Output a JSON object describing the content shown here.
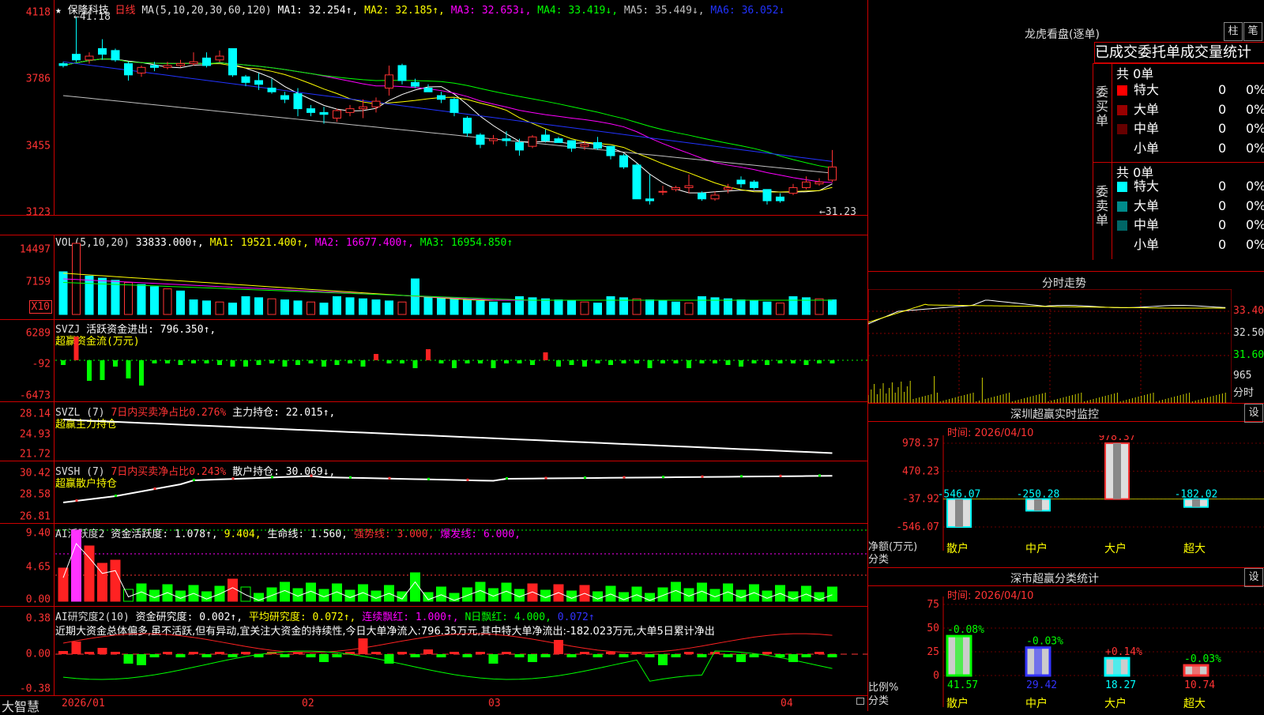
{
  "app": {
    "brand": "大智慧"
  },
  "main": {
    "star": "★",
    "stock_name": "保隆科技",
    "period": "日线",
    "ma_label": "MA(5,10,20,30,60,120)",
    "mas": [
      {
        "text": "MA1: 32.254↑,",
        "color": "#ffffff"
      },
      {
        "text": "MA2: 32.185↑,",
        "color": "#ffff00"
      },
      {
        "text": "MA3: 32.653↓,",
        "color": "#ff00ff"
      },
      {
        "text": "MA4: 33.419↓,",
        "color": "#00ff00"
      },
      {
        "text": "MA5: 35.449↓,",
        "color": "#c0c0c0"
      },
      {
        "text": "MA6: 36.052↓",
        "color": "#2233ff"
      }
    ],
    "y_labels": [
      "4118",
      "3786",
      "3455",
      "3123"
    ],
    "high_note": "←41.18",
    "low_note": "←31.23"
  },
  "vol": {
    "label": "VOL(5,10,20)",
    "value": "33833.000↑,",
    "ma1": "MA1: 19521.400↑,",
    "ma2": "MA2: 16677.400↑,",
    "ma3": "MA3: 16954.850↑",
    "y_labels": [
      "14497",
      "7159"
    ],
    "unit": "X10"
  },
  "svzj": {
    "label": "SVZJ",
    "text": "活跃资金进出: 796.350↑,",
    "sub": "超赢资金流(万元)",
    "y_labels": [
      "6289",
      "-92",
      "-6473"
    ]
  },
  "svzl": {
    "label": "SVZL (7)",
    "ratio": "7日内买卖净占比0.276%",
    "text": "主力持仓: 22.015↑,",
    "sub": "超赢主力持仓",
    "y_labels": [
      "28.14",
      "24.93",
      "21.72"
    ]
  },
  "svsh": {
    "label": "SVSH (7)",
    "ratio": "7日内买卖净占比0.243%",
    "text": "散户持仓: 30.069↓,",
    "sub": "超赢散户持仓",
    "y_labels": [
      "30.42",
      "28.58",
      "26.81"
    ]
  },
  "ai1": {
    "label": "AI活跃度2",
    "text": "资金活跃度: 1.078↑,",
    "v2": "9.404,",
    "life": "生命线: 1.560,",
    "strong": "强势线: 3.000,",
    "burst": "爆发线: 6.000,",
    "y_labels": [
      "9.40",
      "4.65",
      "0.00"
    ]
  },
  "ai2": {
    "label": "AI研究度2(10)",
    "text": "资金研究度: 0.002↑,",
    "avg": "平均研究度: 0.072↑,",
    "cont": "连续飘红: 1.000↑,",
    "n": "N日飘红: 4.000,",
    "last": "0.072↑",
    "comment": "近期大资金总体偏多,虽不活跃,但有异动,宜关注大资金的持续性,今日大单净流入:796.35万元,其中特大单净流出:-182.023万元,大单5日累计净出",
    "y_labels": [
      "0.38",
      "0.00",
      "-0.38"
    ]
  },
  "xaxis": {
    "labels": [
      "2026/01",
      "02",
      "03",
      "04"
    ]
  },
  "lhb": {
    "title": "龙虎看盘(逐单)",
    "btn1": "柱",
    "btn2": "笔",
    "tabs": "已成交委托单成交量统计",
    "buy_side": "委买单",
    "sell_side": "委卖单",
    "buy_total": "共 0单",
    "sell_total": "共 0单",
    "rows_buy": [
      {
        "label": "特大",
        "count": "0",
        "pct": "0%",
        "color": "#ff0000"
      },
      {
        "label": "大单",
        "count": "0",
        "pct": "0%",
        "color": "#990000"
      },
      {
        "label": "中单",
        "count": "0",
        "pct": "0%",
        "color": "#660000"
      },
      {
        "label": "小单",
        "count": "0",
        "pct": "0%",
        "color": "#000000"
      }
    ],
    "rows_sell": [
      {
        "label": "特大",
        "count": "0",
        "pct": "0%",
        "color": "#00ffff"
      },
      {
        "label": "大单",
        "count": "0",
        "pct": "0%",
        "color": "#008b8b"
      },
      {
        "label": "中单",
        "count": "0",
        "pct": "0%",
        "color": "#006666"
      },
      {
        "label": "小单",
        "count": "0",
        "pct": "0%",
        "color": "#000000"
      }
    ]
  },
  "intraday": {
    "title": "分时走势",
    "y_labels": [
      "33.40",
      "32.50",
      "31.60"
    ],
    "vol_label": "965",
    "unit": "分时"
  },
  "sz_monitor": {
    "title": "深圳超赢实时监控",
    "settings": "设",
    "time": "时间: 2026/04/10",
    "y_labels": [
      "978.37",
      "470.23",
      "-37.92",
      "-546.07"
    ],
    "side_label1": "净额(万元)",
    "side_label2": "分类",
    "bars": [
      {
        "cat": "散户",
        "value": "-546.07"
      },
      {
        "cat": "中户",
        "value": "-250.28"
      },
      {
        "cat": "大户",
        "value": "978.37"
      },
      {
        "cat": "超大",
        "value": "-182.02"
      }
    ]
  },
  "sz_class": {
    "title": "深市超赢分类统计",
    "settings": "设",
    "time": "时间: 2026/04/10",
    "y_labels": [
      "75",
      "50",
      "25",
      "0"
    ],
    "side_label1": "比例%",
    "side_label2": "分类",
    "bars": [
      {
        "cat": "散户",
        "value": "41.57",
        "chg": "-0.08%",
        "color": "#00ff00"
      },
      {
        "cat": "中户",
        "value": "29.42",
        "chg": "-0.03%",
        "color": "#3333ff"
      },
      {
        "cat": "大户",
        "value": "18.27",
        "chg": "+0.14%",
        "color": "#00ffff"
      },
      {
        "cat": "超大",
        "value": "10.74",
        "chg": "-0.03%",
        "color": "#ff3333"
      }
    ]
  },
  "chart_data": [
    {
      "type": "candlestick",
      "title": "保隆科技 日线",
      "y_ticks": [
        41.18,
        37.86,
        34.55,
        31.23
      ],
      "ylim": [
        30.9,
        41.5
      ],
      "x": [
        "2026/01",
        "02",
        "03",
        "04"
      ],
      "ohlc_approx": [
        [
          38.7,
          38.8,
          38.5,
          38.6
        ],
        [
          39.2,
          41.2,
          38.8,
          38.9
        ],
        [
          38.9,
          39.3,
          38.7,
          39.1
        ],
        [
          39.5,
          40.0,
          38.9,
          39.2
        ],
        [
          39.4,
          39.5,
          38.8,
          38.9
        ],
        [
          38.7,
          38.8,
          37.8,
          38.1
        ],
        [
          38.2,
          38.6,
          38.0,
          38.5
        ],
        [
          38.6,
          38.8,
          38.3,
          38.5
        ],
        [
          38.5,
          38.8,
          38.4,
          38.6
        ],
        [
          38.6,
          38.9,
          38.5,
          38.7
        ],
        [
          38.7,
          39.3,
          38.6,
          38.8
        ],
        [
          39.0,
          39.3,
          38.5,
          38.6
        ],
        [
          38.9,
          39.4,
          38.8,
          39.1
        ],
        [
          39.5,
          39.5,
          38.0,
          38.1
        ],
        [
          38.0,
          38.1,
          37.5,
          37.7
        ],
        [
          37.8,
          38.2,
          37.3,
          37.6
        ],
        [
          37.4,
          37.9,
          37.1,
          37.2
        ],
        [
          37.0,
          37.2,
          36.6,
          36.8
        ],
        [
          37.1,
          37.4,
          35.9,
          36.3
        ],
        [
          36.3,
          36.5,
          35.9,
          36.1
        ],
        [
          36.1,
          36.4,
          35.5,
          36.0
        ],
        [
          35.8,
          36.3,
          35.6,
          36.2
        ],
        [
          36.1,
          36.5,
          35.9,
          36.3
        ],
        [
          36.3,
          36.8,
          35.8,
          36.4
        ],
        [
          36.4,
          36.9,
          36.1,
          36.7
        ],
        [
          37.4,
          38.6,
          37.0,
          38.1
        ],
        [
          38.6,
          38.7,
          37.6,
          37.8
        ],
        [
          37.7,
          37.9,
          37.4,
          37.5
        ],
        [
          37.4,
          37.6,
          37.2,
          37.2
        ],
        [
          37.0,
          37.2,
          36.6,
          36.8
        ],
        [
          36.8,
          36.9,
          35.9,
          36.1
        ],
        [
          35.8,
          35.9,
          34.8,
          35.0
        ],
        [
          34.9,
          35.0,
          34.2,
          34.4
        ],
        [
          34.6,
          34.9,
          34.4,
          34.7
        ],
        [
          34.7,
          35.1,
          34.3,
          34.6
        ],
        [
          34.5,
          34.7,
          33.8,
          34.1
        ],
        [
          34.3,
          34.9,
          34.2,
          34.8
        ],
        [
          34.9,
          35.2,
          34.5,
          34.6
        ],
        [
          34.7,
          34.8,
          34.5,
          34.5
        ],
        [
          34.6,
          34.6,
          34.0,
          34.2
        ],
        [
          34.3,
          34.6,
          34.1,
          34.4
        ],
        [
          34.5,
          34.8,
          34.1,
          34.2
        ],
        [
          34.3,
          34.3,
          33.6,
          33.8
        ],
        [
          33.8,
          33.9,
          33.1,
          33.2
        ],
        [
          33.3,
          33.4,
          31.6,
          31.5
        ],
        [
          31.5,
          32.8,
          31.2,
          31.4
        ],
        [
          31.9,
          32.2,
          31.7,
          31.9
        ],
        [
          32.0,
          32.2,
          31.9,
          32.1
        ],
        [
          32.1,
          32.8,
          31.8,
          32.2
        ],
        [
          31.8,
          31.9,
          31.4,
          31.5
        ],
        [
          31.5,
          31.9,
          31.4,
          31.7
        ],
        [
          32.0,
          32.3,
          31.8,
          32.1
        ],
        [
          32.5,
          32.7,
          32.1,
          32.3
        ],
        [
          32.4,
          32.5,
          32.0,
          32.1
        ],
        [
          32.0,
          32.0,
          31.2,
          31.4
        ],
        [
          31.6,
          31.8,
          31.3,
          31.4
        ],
        [
          31.8,
          32.3,
          31.7,
          32.1
        ],
        [
          32.1,
          32.7,
          32.0,
          32.4
        ],
        [
          32.3,
          32.6,
          32.2,
          32.4
        ],
        [
          32.5,
          34.1,
          32.4,
          33.2
        ]
      ]
    },
    {
      "type": "bar",
      "title": "深圳超赢实时监控",
      "categories": [
        "散户",
        "中户",
        "大户",
        "超大"
      ],
      "values": [
        -546.07,
        -250.28,
        978.37,
        -182.02
      ],
      "ylabel": "净额(万元)",
      "ylim": [
        -546.07,
        978.37
      ]
    },
    {
      "type": "bar",
      "title": "深市超赢分类统计",
      "categories": [
        "散户",
        "中户",
        "大户",
        "超大"
      ],
      "values": [
        41.57,
        29.42,
        18.27,
        10.74
      ],
      "ylabel": "比例%",
      "ylim": [
        0,
        75
      ]
    }
  ]
}
